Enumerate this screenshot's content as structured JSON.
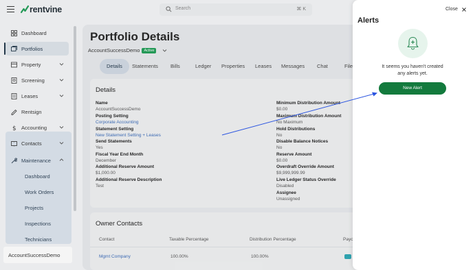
{
  "brand": {
    "name": "rentvine",
    "accent": "#137a3d"
  },
  "search": {
    "placeholder": "Search",
    "shortcut": "⌘ K"
  },
  "sidebar": {
    "items": [
      {
        "label": "Dashboard",
        "icon": "dashboard-icon"
      },
      {
        "label": "Portfolios",
        "icon": "portfolios-icon",
        "active": true
      },
      {
        "label": "Property",
        "icon": "property-icon",
        "chevron": true
      },
      {
        "label": "Screening",
        "icon": "screening-icon",
        "chevron": true
      },
      {
        "label": "Leases",
        "icon": "leases-icon",
        "chevron": true
      },
      {
        "label": "Rentsign",
        "icon": "rentsign-icon"
      },
      {
        "label": "Accounting",
        "icon": "dollar-icon",
        "chevron": true
      },
      {
        "label": "Contacts",
        "icon": "contacts-icon",
        "chevron": true
      },
      {
        "label": "Maintenance",
        "icon": "wrench-icon",
        "chevron": "up"
      }
    ],
    "maintenance_sub": [
      "Dashboard",
      "Work Orders",
      "Projects",
      "Inspections",
      "Technicians"
    ],
    "account_footer": "AccountSuccessDemo"
  },
  "page": {
    "title": "Portfolio Details",
    "account": "AccountSuccessDemo",
    "status": "Active",
    "tabs": [
      "Details",
      "Statements",
      "Bills",
      "Ledger",
      "Properties",
      "Leases",
      "Messages",
      "Chat",
      "File"
    ]
  },
  "details": {
    "title": "Details",
    "left": [
      {
        "label": "Name",
        "value": "AccountSuccessDemo"
      },
      {
        "label": "Posting Setting",
        "value": "Corporate Accounting",
        "link": true
      },
      {
        "label": "Statement Setting",
        "value": "New Statement Setting + Leases",
        "link": true
      },
      {
        "label": "Send Statements",
        "value": "Yes"
      },
      {
        "label": "Fiscal Year End Month",
        "value": "December"
      },
      {
        "label": "Additional Reserve Amount",
        "value": "$1,000.00"
      },
      {
        "label": "Additional Reserve Description",
        "value": "Test"
      }
    ],
    "right": [
      {
        "label": "Minimum Distribution Amount",
        "value": "$0.00"
      },
      {
        "label": "Maximum Distribution Amount",
        "value": "No Maximum"
      },
      {
        "label": "Hold Distributions",
        "value": "No"
      },
      {
        "label": "Disable Balance Notices",
        "value": "No"
      },
      {
        "label": "Reserve Amount",
        "value": "$0.00"
      },
      {
        "label": "Overdraft Override Amount",
        "value": "$9,999,999.99"
      },
      {
        "label": "Live Ledger Status Override",
        "value": "Disabled"
      },
      {
        "label": "Assignee",
        "value": "Unassigned"
      }
    ]
  },
  "owners": {
    "title": "Owner Contacts",
    "columns": [
      "Contact",
      "Taxable Percentage",
      "Distribution Percentage",
      "Payo"
    ],
    "rows": [
      {
        "contact": "Mgmt Company",
        "taxable": "100.00%",
        "distribution": "100.00%"
      }
    ]
  },
  "alerts": {
    "close_label": "Close",
    "title": "Alerts",
    "empty_message": "It seems you haven't created any alerts yet.",
    "new_alert_label": "New Alert"
  }
}
